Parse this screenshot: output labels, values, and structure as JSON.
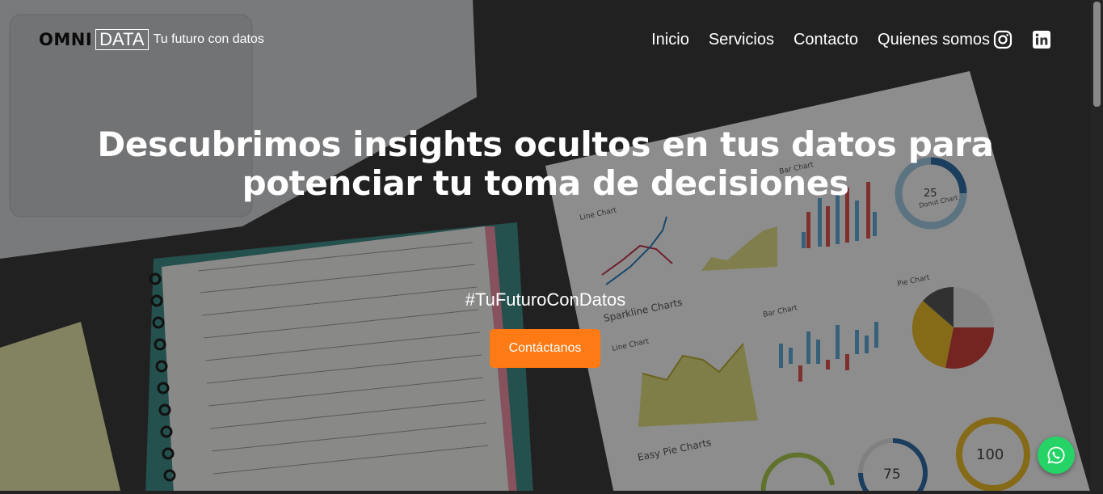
{
  "brand": {
    "omni": "OMNI",
    "data": "DATA",
    "tagline": "Tu futuro con datos"
  },
  "nav": {
    "items": [
      "Inicio",
      "Servicios",
      "Contacto",
      "Quienes somos"
    ]
  },
  "social": {
    "instagram": "instagram-icon",
    "linkedin": "linkedin-icon"
  },
  "hero": {
    "headline_line1": "Descubrimos insights ocultos en tus datos para",
    "headline_line2": "potenciar tu toma de decisiones",
    "hashtag": "#TuFuturoConDatos",
    "cta_label": "Contáctanos"
  },
  "background_print": {
    "titles": [
      "Bar Chart",
      "Line Chart",
      "Sparkline Charts",
      "Bar Chart",
      "Pie Chart",
      "Line Chart",
      "Easy Pie Charts",
      "Donut Chart"
    ],
    "donut_percent": "25",
    "easy_pie_values": [
      "75",
      "100"
    ]
  },
  "colors": {
    "accent": "#fd7a14",
    "whatsapp": "#25d366"
  }
}
